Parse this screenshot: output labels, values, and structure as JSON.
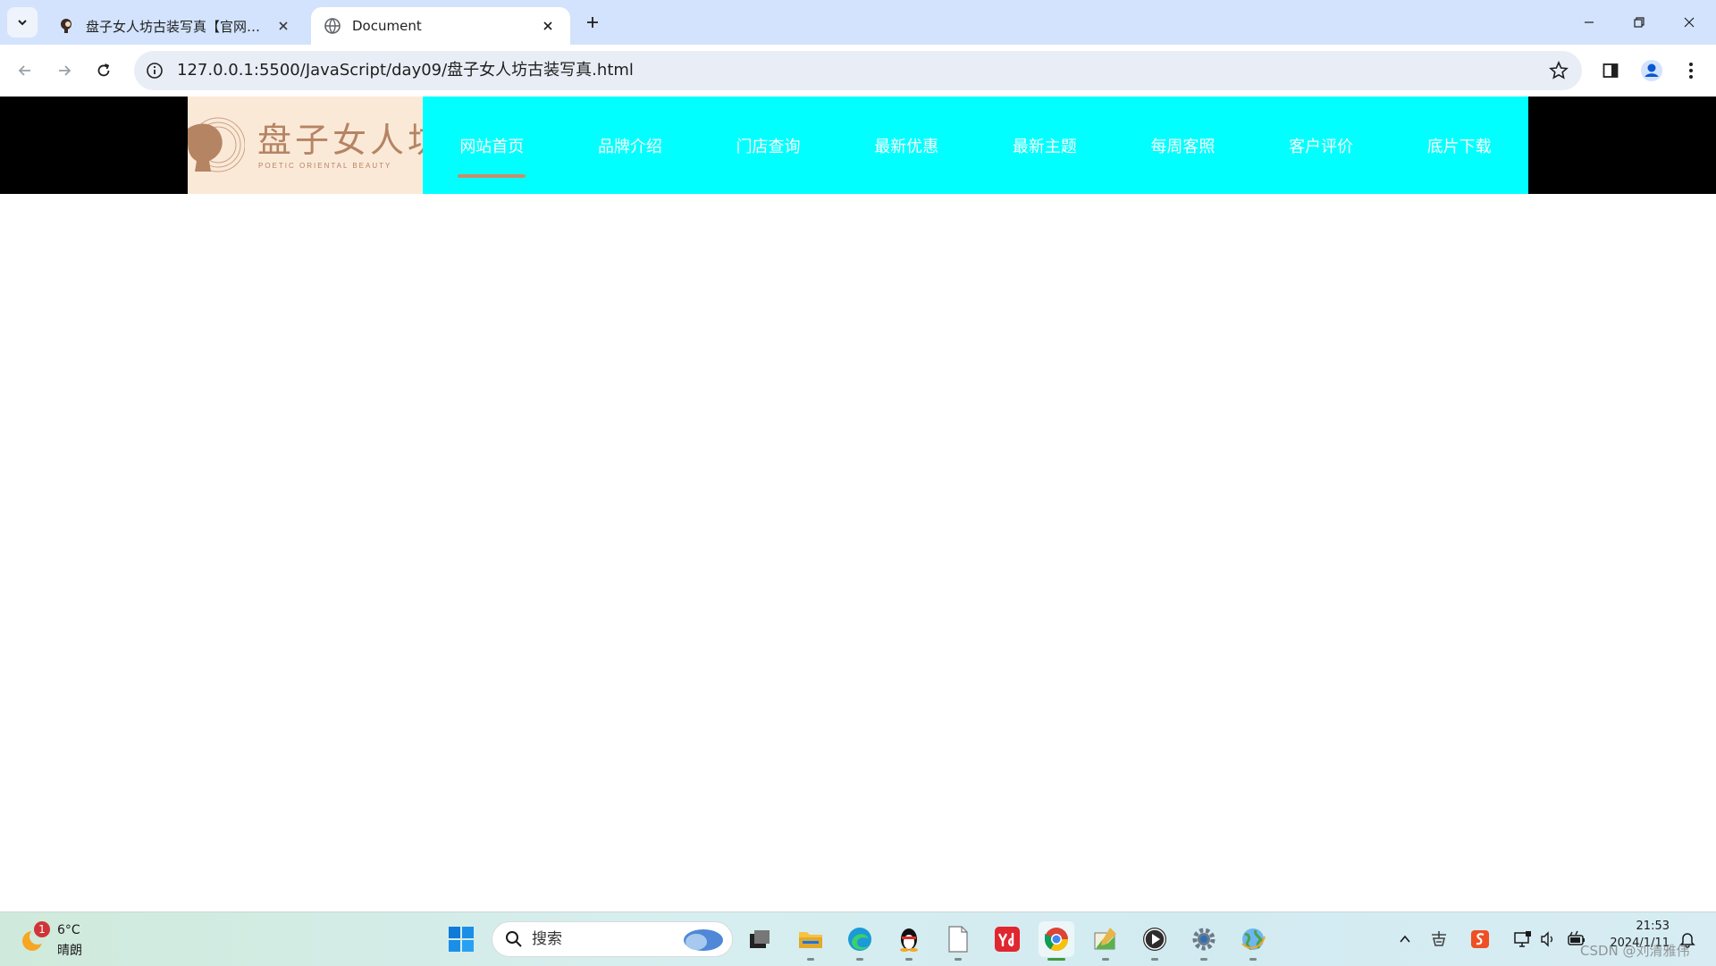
{
  "browser": {
    "tabs": [
      {
        "title": "盘子女人坊古装写真【官网】_古装写真",
        "active": false,
        "favicon": "woman-silhouette-icon"
      },
      {
        "title": "Document",
        "active": true,
        "favicon": "globe-icon"
      }
    ],
    "url": "127.0.0.1:5500/JavaScript/day09/盘子女人坊古装写真.html"
  },
  "site": {
    "logo": {
      "name": "盘子女人坊",
      "tagline": "POETIC ORIENTAL BEAUTY"
    },
    "nav": [
      {
        "label": "网站首页",
        "active": true
      },
      {
        "label": "品牌介绍",
        "active": false
      },
      {
        "label": "门店查询",
        "active": false
      },
      {
        "label": "最新优惠",
        "active": false
      },
      {
        "label": "最新主题",
        "active": false
      },
      {
        "label": "每周客照",
        "active": false
      },
      {
        "label": "客户评价",
        "active": false
      },
      {
        "label": "底片下载",
        "active": false
      }
    ],
    "colors": {
      "header_bg": "#000000",
      "nav_bg": "#00ffff",
      "logo_bg": "#fbe9d8",
      "accent": "#c88f6a"
    }
  },
  "taskbar": {
    "weather": {
      "temp": "6°C",
      "condition": "晴朗",
      "badge": "1"
    },
    "search_placeholder": "搜索",
    "clock": {
      "time": "21:53",
      "date": "2024/1/11"
    },
    "watermark": "CSDN @刘清雅伟"
  }
}
